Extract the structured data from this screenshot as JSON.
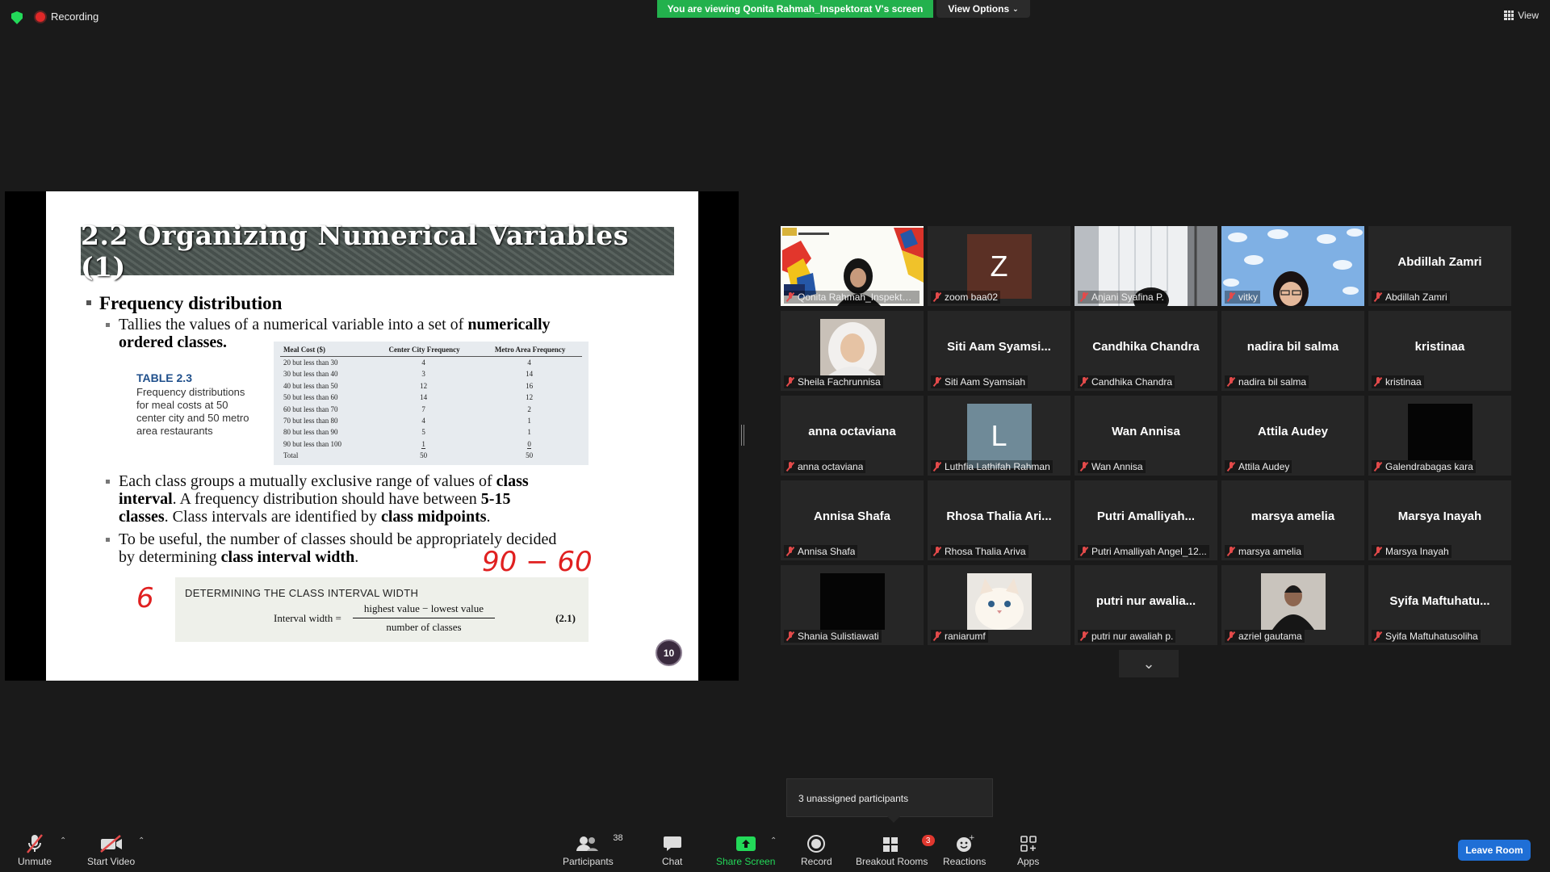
{
  "topbar": {
    "recording": "Recording",
    "viewing_banner": "You are viewing Qonita Rahmah_Inspektorat V's screen",
    "view_options": "View Options",
    "view": "View"
  },
  "slide": {
    "title": "2.2 Organizing Numerical Variables (1)",
    "bullet_freq": "Frequency distribution",
    "tallies_a": "Tallies the values of a numerical variable into a set of ",
    "tallies_b": "numerically",
    "tallies_c": "ordered classes.",
    "table_caption_title": "TABLE 2.3",
    "table_caption_body": "Frequency distributions for meal costs at 50 center city and 50 metro area restaurants",
    "table": {
      "headers": [
        "Meal Cost ($)",
        "Center City Frequency",
        "Metro Area Frequency"
      ],
      "rows": [
        [
          "20 but less than 30",
          "4",
          "4"
        ],
        [
          "30 but less than 40",
          "3",
          "14"
        ],
        [
          "40 but less than 50",
          "12",
          "16"
        ],
        [
          "50 but less than 60",
          "14",
          "12"
        ],
        [
          "60 but less than 70",
          "7",
          "2"
        ],
        [
          "70 but less than 80",
          "4",
          "1"
        ],
        [
          "80 but less than 90",
          "5",
          "1"
        ],
        [
          "90 but less than 100",
          "1",
          "0"
        ],
        [
          "Total",
          "50",
          "50"
        ]
      ]
    },
    "each_class_1": "Each class groups a mutually exclusive range of values of ",
    "each_class_2": "class",
    "each_class_3": "interval",
    "each_class_4": ". A frequency distribution should have between ",
    "each_class_5": "5-15",
    "each_class_6": "classes",
    "each_class_7": ". Class intervals are identified by ",
    "each_class_8": "class midpoints",
    "each_class_9": ".",
    "useful_1": "To be useful, the number of classes should be appropriately decided",
    "useful_2": "by determining ",
    "useful_3": "class interval width",
    "useful_4": ".",
    "formula_heading": "DETERMINING THE CLASS INTERVAL WIDTH",
    "formula_lhs": "Interval width =",
    "formula_numerator": "highest value − lowest value",
    "formula_denominator": "number of classes",
    "formula_number": "(2.1)",
    "slide_number": "10",
    "handwriting_1": "90 − 60",
    "handwriting_2": "6"
  },
  "participants_tiles": [
    {
      "label": "Qonita Rahmah_Inspektorat...",
      "center": "",
      "kind": "screenshare",
      "active": true
    },
    {
      "label": "zoom baa02",
      "center": "",
      "kind": "letter",
      "letter": "Z",
      "color": "#5b3025"
    },
    {
      "label": "Anjani Syafina P.",
      "center": "",
      "kind": "camera-room"
    },
    {
      "label": "vitky",
      "center": "",
      "kind": "camera-sky"
    },
    {
      "label": "Abdillah Zamri",
      "center": "Abdillah Zamri",
      "kind": "name"
    },
    {
      "label": "Sheila Fachrunnisa",
      "center": "",
      "kind": "photo-hijab"
    },
    {
      "label": "Siti Aam Syamsiah",
      "center": "Siti  Aam  Syamsi...",
      "kind": "name"
    },
    {
      "label": "Candhika Chandra",
      "center": "Candhika Chandra",
      "kind": "name"
    },
    {
      "label": "nadira bil salma",
      "center": "nadira bil salma",
      "kind": "name"
    },
    {
      "label": "kristinaa",
      "center": "kristinaa",
      "kind": "name"
    },
    {
      "label": "anna octaviana",
      "center": "anna octaviana",
      "kind": "name"
    },
    {
      "label": "Luthfia Lathifah Rahman",
      "center": "",
      "kind": "letter",
      "letter": "L",
      "color": "#6f8a98"
    },
    {
      "label": "Wan Annisa",
      "center": "Wan Annisa",
      "kind": "name"
    },
    {
      "label": "Attila Audey",
      "center": "Attila Audey",
      "kind": "name"
    },
    {
      "label": "Galendrabagas kara",
      "center": "",
      "kind": "black"
    },
    {
      "label": "Annisa Shafa",
      "center": "Annisa Shafa",
      "kind": "name"
    },
    {
      "label": "Rhosa Thalia Ariva",
      "center": "Rhosa  Thalia  Ari...",
      "kind": "name"
    },
    {
      "label": "Putri Amalliyah Angel_12...",
      "center": "Putri  Amalliyah...",
      "kind": "name"
    },
    {
      "label": "marsya amelia",
      "center": "marsya amelia",
      "kind": "name"
    },
    {
      "label": "Marsya Inayah",
      "center": "Marsya Inayah",
      "kind": "name"
    },
    {
      "label": "Shania Sulistiawati",
      "center": "",
      "kind": "black"
    },
    {
      "label": "raniarumf",
      "center": "",
      "kind": "photo-cat"
    },
    {
      "label": "putri nur awaliah p.",
      "center": "putri  nur  awalia...",
      "kind": "name"
    },
    {
      "label": "azriel gautama",
      "center": "",
      "kind": "photo-person"
    },
    {
      "label": "Syifa Maftuhatusoliha",
      "center": "Syifa  Maftuhatu...",
      "kind": "name"
    }
  ],
  "tooltip": "3 unassigned participants",
  "toolbar": {
    "unmute": "Unmute",
    "start_video": "Start Video",
    "participants": "Participants",
    "participants_count": "38",
    "chat": "Chat",
    "share_screen": "Share Screen",
    "record": "Record",
    "breakout_rooms": "Breakout Rooms",
    "breakout_badge": "3",
    "reactions": "Reactions",
    "apps": "Apps",
    "leave": "Leave Room"
  },
  "colors": {
    "share_green": "#23d959",
    "active_speaker": "#d4e24a",
    "leave_blue": "#1f6fd6",
    "muted_red": "#e34a4a"
  }
}
